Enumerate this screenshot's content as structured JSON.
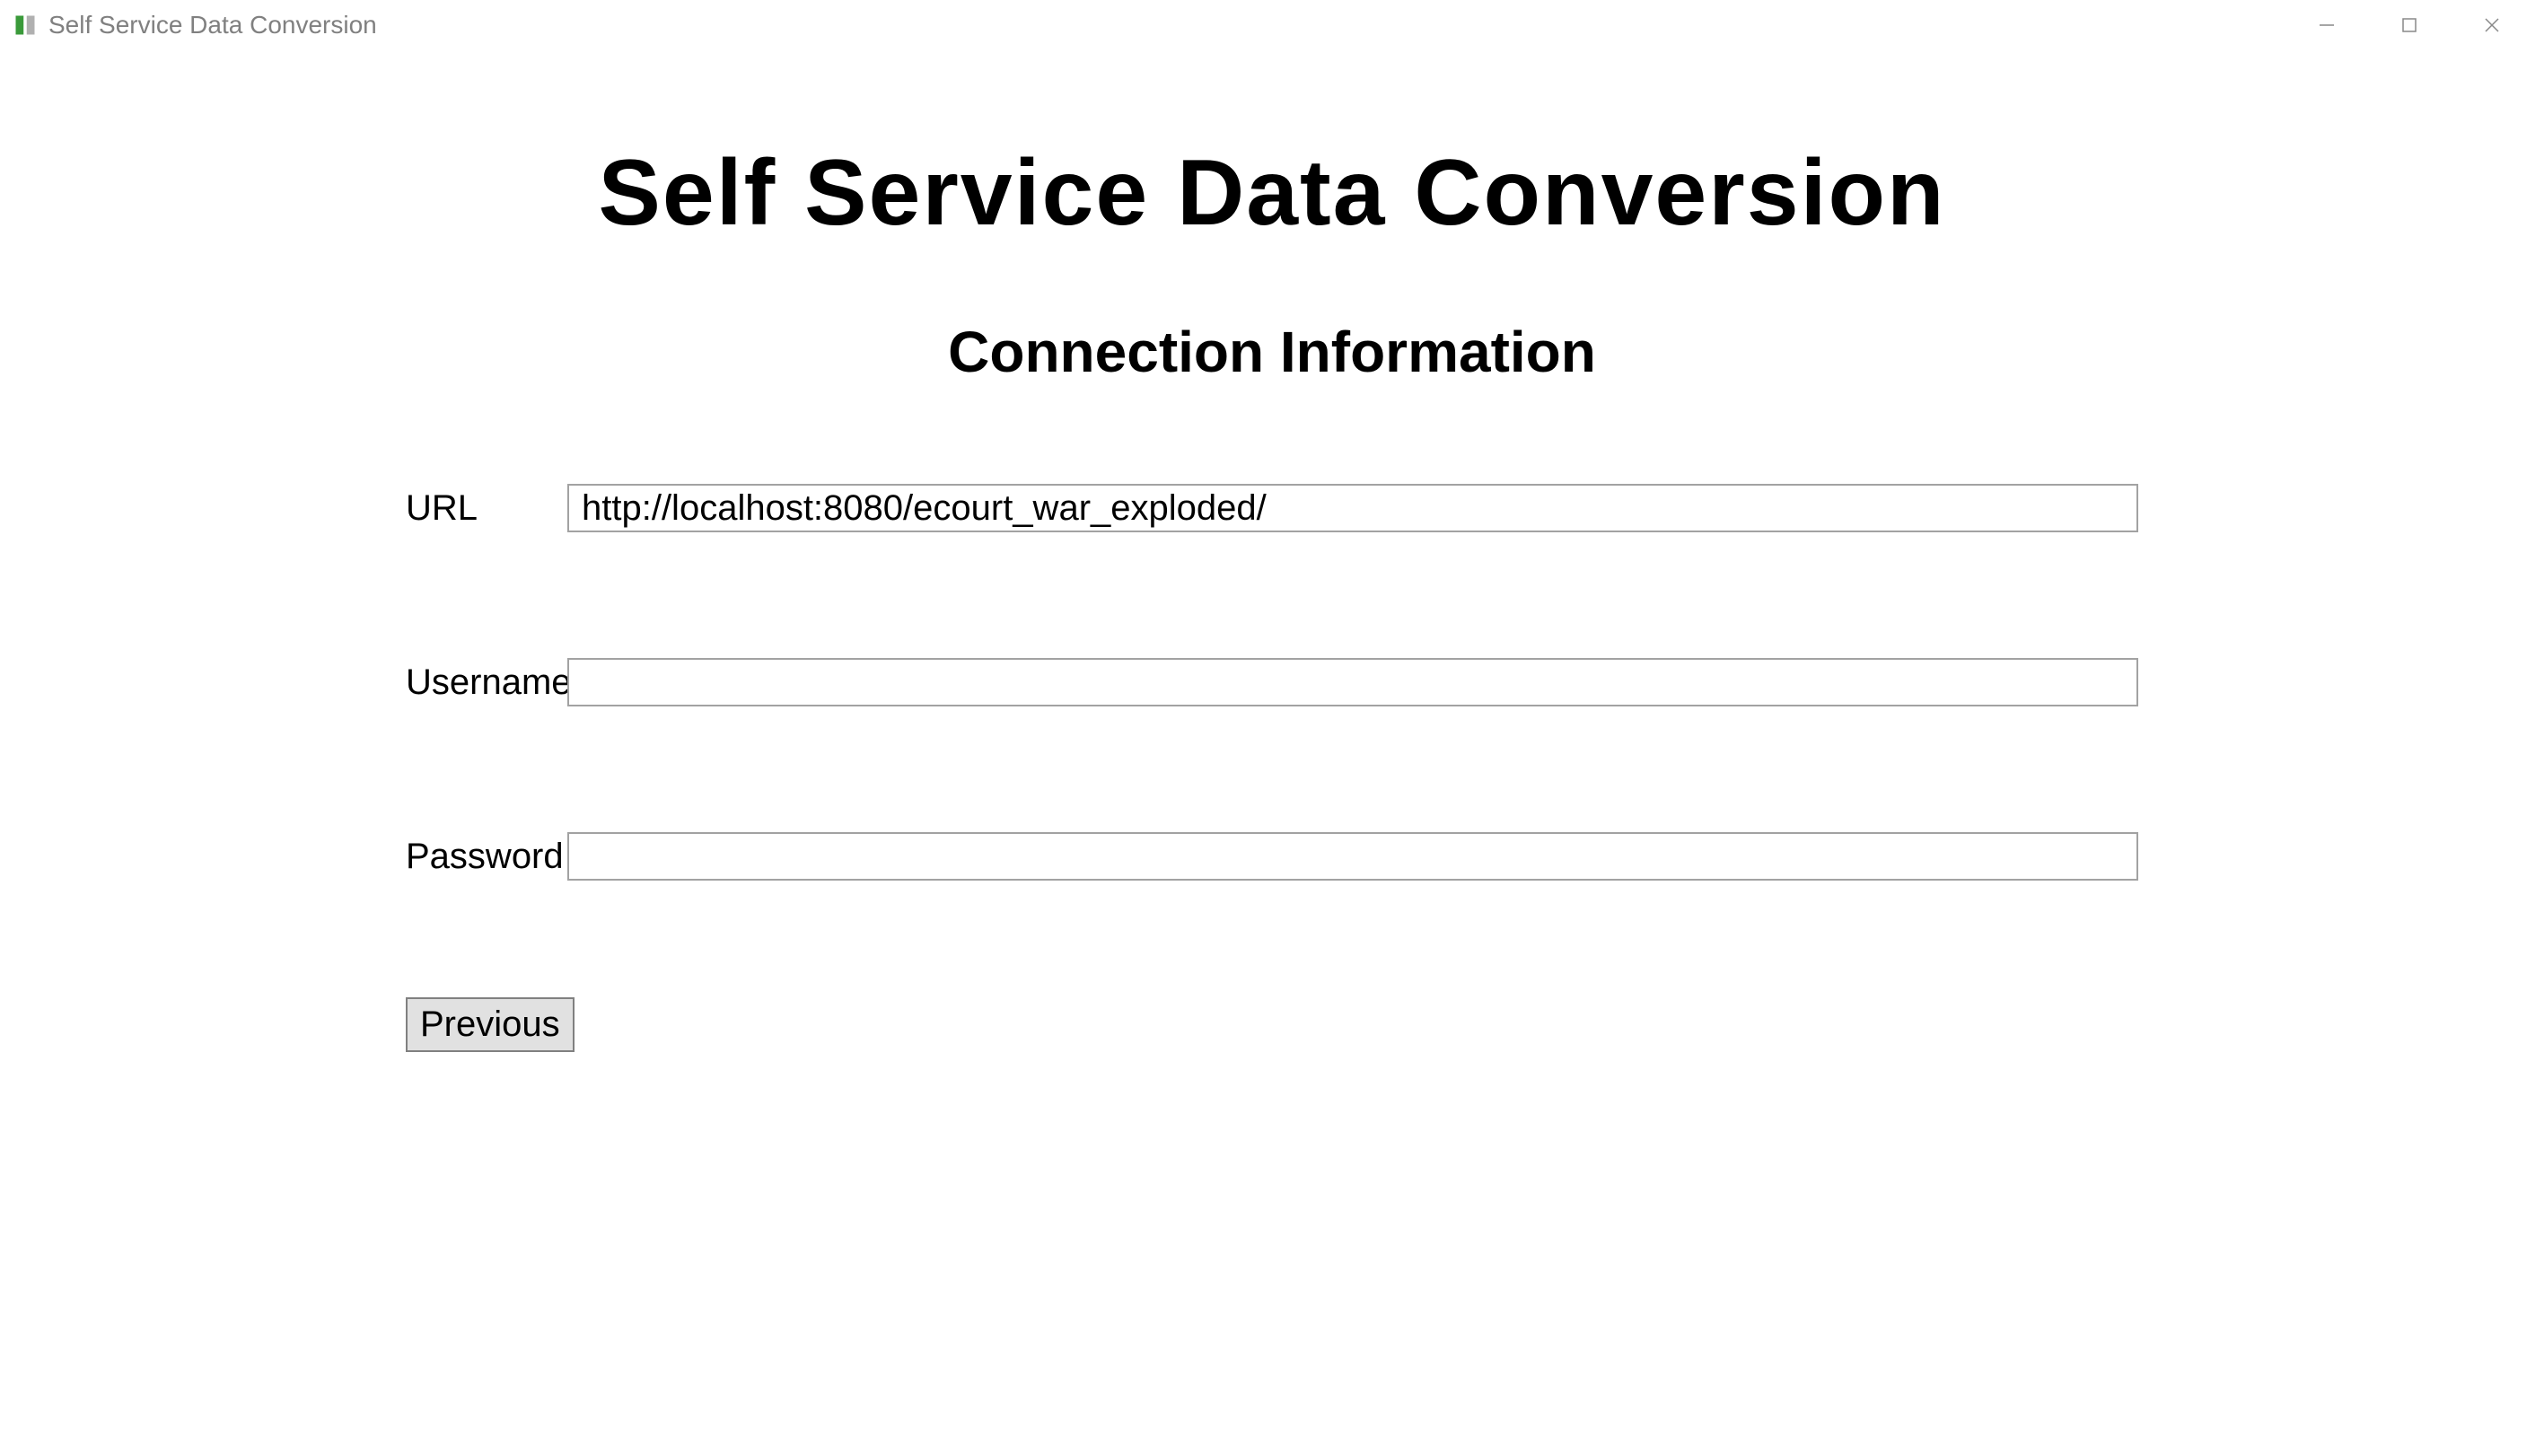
{
  "titlebar": {
    "title": "Self Service Data Conversion"
  },
  "page": {
    "title": "Self Service Data Conversion",
    "section_title": "Connection Information"
  },
  "form": {
    "url_label": "URL",
    "url_value": "http://localhost:8080/ecourt_war_exploded/",
    "username_label": "Username",
    "username_value": "",
    "password_label": "Password",
    "password_value": "",
    "previous_label": "Previous"
  }
}
